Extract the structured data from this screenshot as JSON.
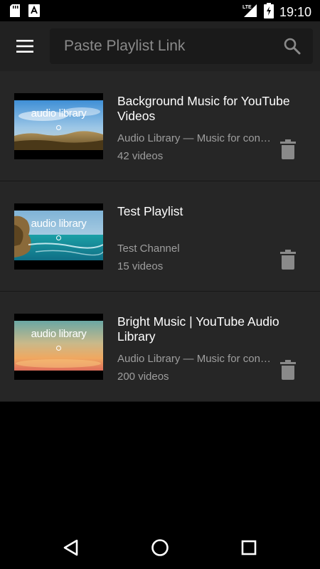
{
  "status_bar": {
    "time": "19:10",
    "left_icons": [
      "sd-card-icon",
      "app-notification-icon"
    ],
    "right_icons": [
      "lte-signal-icon",
      "battery-charging-icon"
    ],
    "network_label": "LTE"
  },
  "search": {
    "placeholder": "Paste Playlist Link",
    "value": ""
  },
  "playlists": [
    {
      "title": "Background Music for YouTube Videos",
      "channel": "Audio Library — Music for content creators",
      "count": "42 videos",
      "thumbnail_text": "audio library"
    },
    {
      "title": "Test Playlist",
      "channel": "Test Channel",
      "count": "15 videos",
      "thumbnail_text": "audio library"
    },
    {
      "title": "Bright Music | YouTube Audio Library",
      "channel": "Audio Library — Music for content creators",
      "count": "200 videos",
      "thumbnail_text": "audio library"
    }
  ],
  "nav": {
    "buttons": [
      "back-icon",
      "home-icon",
      "recents-icon"
    ]
  },
  "colors": {
    "app_bar": "#212121",
    "search_box": "#1a1a1a",
    "list_item": "#262626",
    "background": "#000000",
    "title_text": "#ffffff",
    "secondary_text": "#9e9e9e",
    "icon_gray": "#8a8a8a"
  }
}
